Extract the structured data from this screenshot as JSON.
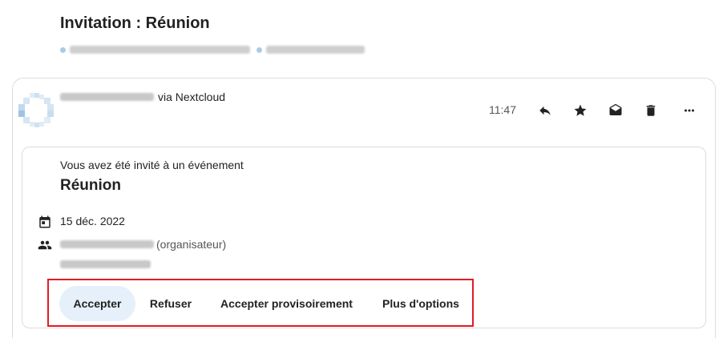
{
  "message": {
    "subject": "Invitation : Réunion",
    "via_text": "via Nextcloud",
    "time": "11:47"
  },
  "icons": {
    "reply": "reply-icon",
    "star": "star-icon",
    "mark_unread": "envelope-open-icon",
    "delete": "trash-icon",
    "more": "more-horizontal-icon"
  },
  "invitation": {
    "intro": "Vous avez été invité à un événement",
    "title": "Réunion",
    "date": "15 déc. 2022",
    "organizer_role": "(organisateur)"
  },
  "actions": {
    "accept": "Accepter",
    "decline": "Refuser",
    "tentative": "Accepter provisoirement",
    "more": "Plus d'options"
  },
  "colors": {
    "primary_bg": "#e5f0fa",
    "highlight": "#e31b23"
  }
}
